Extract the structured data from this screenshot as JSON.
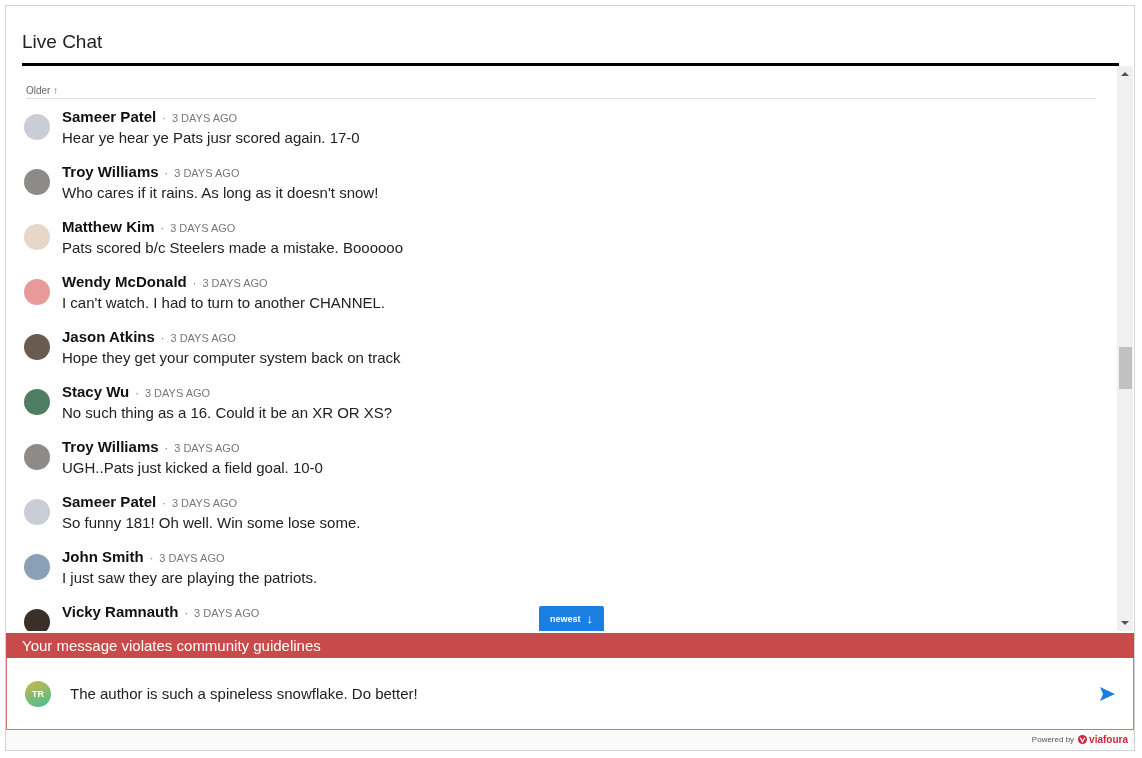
{
  "title": "Live Chat",
  "older_label": "Older ↑",
  "separator": "·",
  "messages": [
    {
      "author": "Sameer Patel",
      "time": "3 DAYS AGO",
      "text": "Hear ye hear ye Pats jusr scored again. 17-0"
    },
    {
      "author": "Troy Williams",
      "time": "3 DAYS AGO",
      "text": "Who cares if it rains. As long as it doesn't snow!"
    },
    {
      "author": "Matthew Kim",
      "time": "3 DAYS AGO",
      "text": "Pats scored b/c Steelers made a mistake. Boooooo"
    },
    {
      "author": "Wendy McDonald",
      "time": "3 DAYS AGO",
      "text": "I can't watch. I had to turn to another CHANNEL."
    },
    {
      "author": "Jason Atkins",
      "time": "3 DAYS AGO",
      "text": "Hope they get your computer system back on track"
    },
    {
      "author": "Stacy Wu",
      "time": "3 DAYS AGO",
      "text": "No such thing as a 16. Could it be an XR OR XS?"
    },
    {
      "author": "Troy Williams",
      "time": "3 DAYS AGO",
      "text": "UGH..Pats just kicked a field goal. 10-0"
    },
    {
      "author": "Sameer Patel",
      "time": "3 DAYS AGO",
      "text": "So funny 181! Oh well. Win some lose some."
    },
    {
      "author": "John Smith",
      "time": "3 DAYS AGO",
      "text": "I just saw they are playing the patriots."
    },
    {
      "author": "Vicky Ramnauth",
      "time": "3 DAYS AGO"
    }
  ],
  "newest_button": {
    "label": "newest",
    "icon": "↓"
  },
  "error_banner": "Your message violates community guidelines",
  "composer": {
    "initials": "TR",
    "value": "The author is such a spineless snowflake. Do better!"
  },
  "footer": {
    "powered_by": "Powered by",
    "brand": "viafoura"
  }
}
